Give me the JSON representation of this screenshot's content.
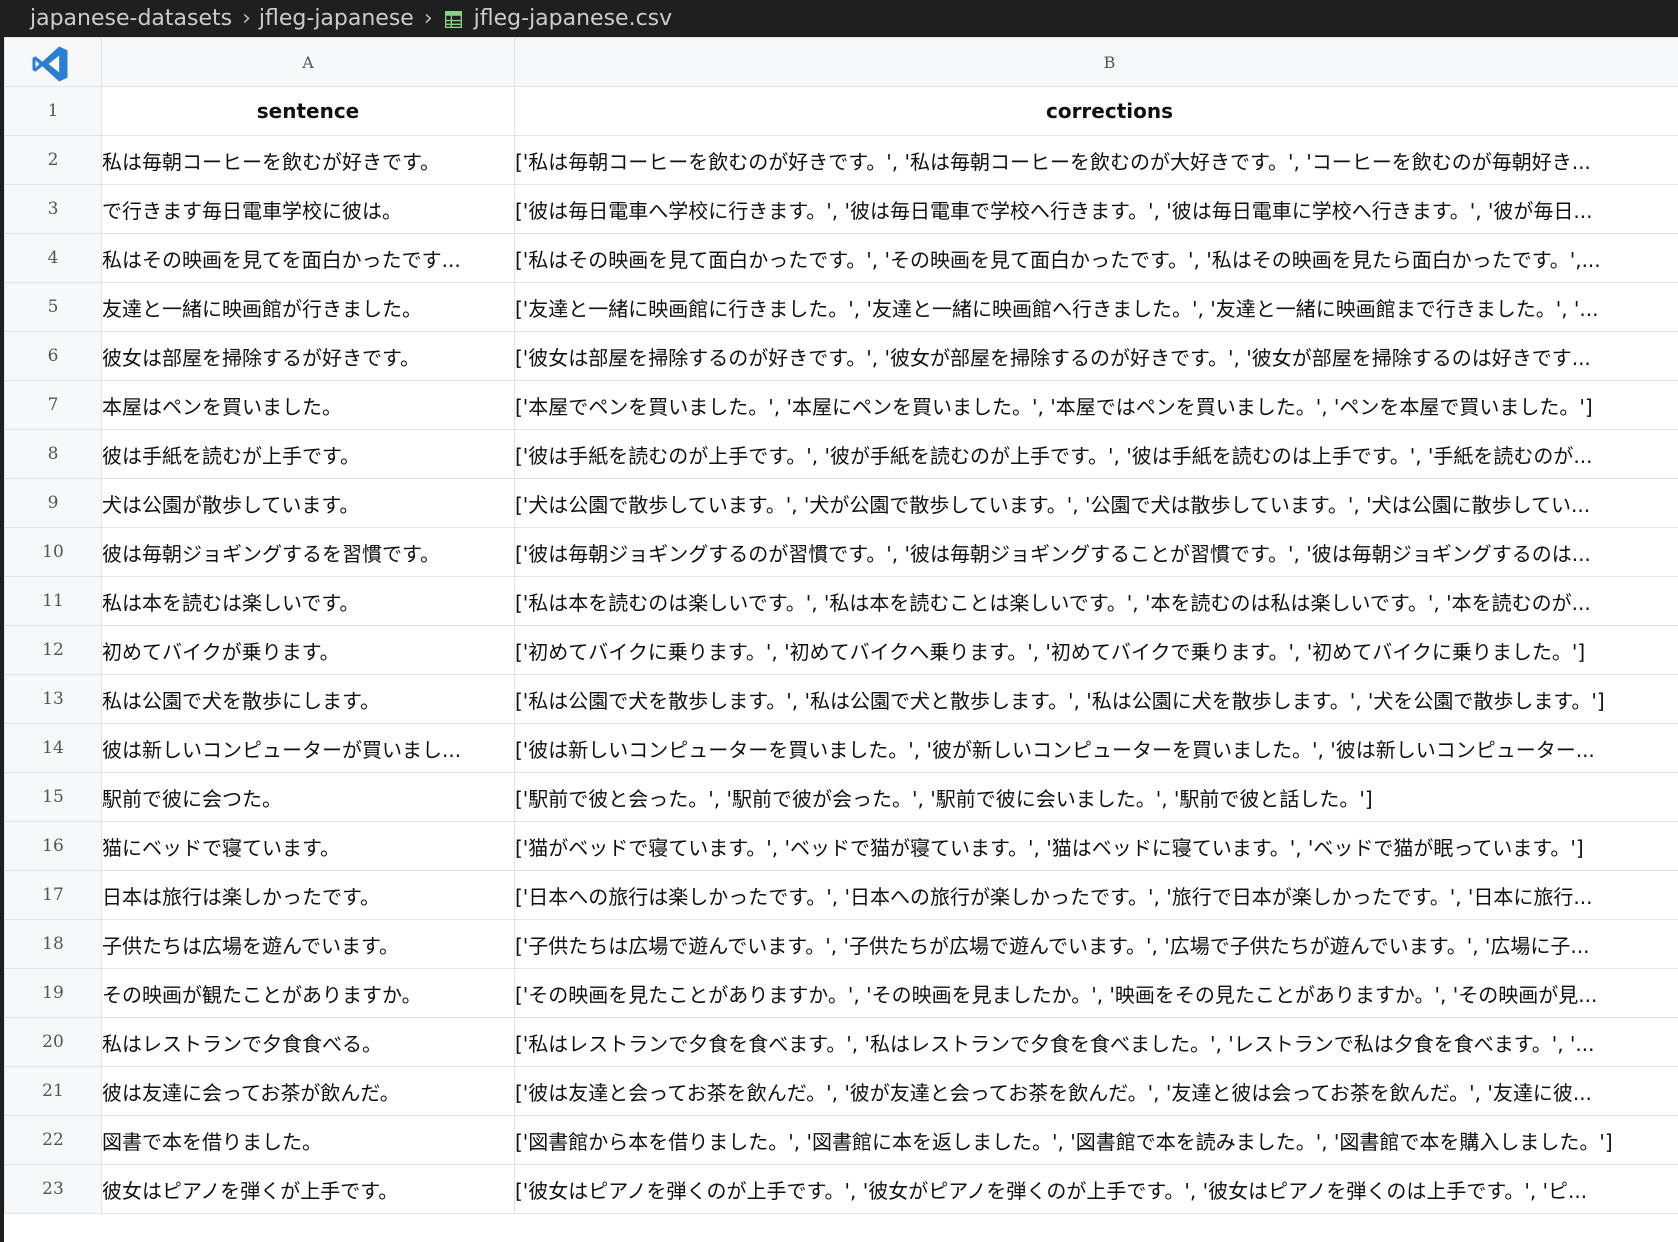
{
  "breadcrumb": {
    "items": [
      "japanese-datasets",
      "jfleg-japanese"
    ],
    "file": "jfleg-japanese.csv"
  },
  "colors": {
    "titlebar_bg": "#1f1f1f",
    "csv_icon": "#89d185",
    "vscode_blue": "#2a7fd4",
    "header_bg": "#f7f8fa"
  },
  "icons": {
    "app": "vscode-logo-icon",
    "file": "csv-table-icon",
    "separator": "chevron-right-icon"
  },
  "grid": {
    "column_letters": [
      "A",
      "B"
    ],
    "headers": [
      "sentence",
      "corrections"
    ],
    "rows": [
      {
        "n": "2",
        "a": "私は毎朝コーヒーを飲むが好きです。",
        "b": "['私は毎朝コーヒーを飲むのが好きです。', '私は毎朝コーヒーを飲むのが大好きです。', 'コーヒーを飲むのが毎朝好き..."
      },
      {
        "n": "3",
        "a": "で行きます毎日電車学校に彼は。",
        "b": "['彼は毎日電車へ学校に行きます。', '彼は毎日電車で学校へ行きます。', '彼は毎日電車に学校へ行きます。', '彼が毎日..."
      },
      {
        "n": "4",
        "a": "私はその映画を見てを面白かったです...",
        "b": "['私はその映画を見て面白かったです。', 'その映画を見て面白かったです。', '私はその映画を見たら面白かったです。',..."
      },
      {
        "n": "5",
        "a": "友達と一緒に映画館が行きました。",
        "b": "['友達と一緒に映画館に行きました。', '友達と一緒に映画館へ行きました。', '友達と一緒に映画館まで行きました。', '..."
      },
      {
        "n": "6",
        "a": "彼女は部屋を掃除するが好きです。",
        "b": "['彼女は部屋を掃除するのが好きです。', '彼女が部屋を掃除するのが好きです。', '彼女が部屋を掃除するのは好きです..."
      },
      {
        "n": "7",
        "a": "本屋はペンを買いました。",
        "b": "['本屋でペンを買いました。', '本屋にペンを買いました。', '本屋ではペンを買いました。', 'ペンを本屋で買いました。']"
      },
      {
        "n": "8",
        "a": "彼は手紙を読むが上手です。",
        "b": "['彼は手紙を読むのが上手です。', '彼が手紙を読むのが上手です。', '彼は手紙を読むのは上手です。', '手紙を読むのが..."
      },
      {
        "n": "9",
        "a": "犬は公園が散歩しています。",
        "b": "['犬は公園で散歩しています。', '犬が公園で散歩しています。', '公園で犬は散歩しています。', '犬は公園に散歩してい..."
      },
      {
        "n": "10",
        "a": "彼は毎朝ジョギングするを習慣です。",
        "b": "['彼は毎朝ジョギングするのが習慣です。', '彼は毎朝ジョギングすることが習慣です。', '彼は毎朝ジョギングするのは..."
      },
      {
        "n": "11",
        "a": "私は本を読むは楽しいです。",
        "b": "['私は本を読むのは楽しいです。', '私は本を読むことは楽しいです。', '本を読むのは私は楽しいです。', '本を読むのが..."
      },
      {
        "n": "12",
        "a": "初めてバイクが乗ります。",
        "b": "['初めてバイクに乗ります。', '初めてバイクへ乗ります。', '初めてバイクで乗ります。', '初めてバイクに乗りました。']"
      },
      {
        "n": "13",
        "a": "私は公園で犬を散歩にします。",
        "b": "['私は公園で犬を散歩します。', '私は公園で犬と散歩します。', '私は公園に犬を散歩します。', '犬を公園で散歩します。']"
      },
      {
        "n": "14",
        "a": "彼は新しいコンピューターが買いまし...",
        "b": "['彼は新しいコンピューターを買いました。', '彼が新しいコンピューターを買いました。', '彼は新しいコンピューター..."
      },
      {
        "n": "15",
        "a": "駅前で彼に会つた。",
        "b": "['駅前で彼と会った。', '駅前で彼が会った。', '駅前で彼に会いました。', '駅前で彼と話した。']"
      },
      {
        "n": "16",
        "a": "猫にベッドで寝ています。",
        "b": "['猫がベッドで寝ています。', 'ベッドで猫が寝ています。', '猫はベッドに寝ています。', 'ベッドで猫が眠っています。']"
      },
      {
        "n": "17",
        "a": "日本は旅行は楽しかったです。",
        "b": "['日本への旅行は楽しかったです。', '日本への旅行が楽しかったです。', '旅行で日本が楽しかったです。', '日本に旅行..."
      },
      {
        "n": "18",
        "a": "子供たちは広場を遊んでいます。",
        "b": "['子供たちは広場で遊んでいます。', '子供たちが広場で遊んでいます。', '広場で子供たちが遊んでいます。', '広場に子..."
      },
      {
        "n": "19",
        "a": "その映画が観たことがありますか。",
        "b": "['その映画を見たことがありますか。', 'その映画を見ましたか。', '映画をその見たことがありますか。', 'その映画が見..."
      },
      {
        "n": "20",
        "a": "私はレストランで夕食食べる。",
        "b": "['私はレストランで夕食を食べます。', '私はレストランで夕食を食べました。', 'レストランで私は夕食を食べます。', '..."
      },
      {
        "n": "21",
        "a": "彼は友達に会ってお茶が飲んだ。",
        "b": "['彼は友達と会ってお茶を飲んだ。', '彼が友達と会ってお茶を飲んだ。', '友達と彼は会ってお茶を飲んだ。', '友達に彼..."
      },
      {
        "n": "22",
        "a": "図書で本を借りました。",
        "b": "['図書館から本を借りました。', '図書館に本を返しました。', '図書館で本を読みました。', '図書館で本を購入しました。']"
      },
      {
        "n": "23",
        "a": "彼女はピアノを弾くが上手です。",
        "b": "['彼女はピアノを弾くのが上手です。', '彼女がピアノを弾くのが上手です。', '彼女はピアノを弾くのは上手です。', 'ピ..."
      }
    ]
  }
}
